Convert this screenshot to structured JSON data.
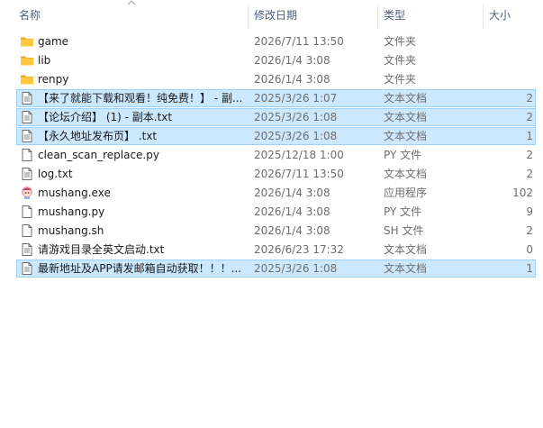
{
  "columns": {
    "name": "名称",
    "date": "修改日期",
    "type": "类型",
    "size": "大小"
  },
  "files": [
    {
      "name": "game",
      "date": "2026/7/11 13:50",
      "type": "文件夹",
      "size": "",
      "icon": "folder-icon",
      "selected": false
    },
    {
      "name": "lib",
      "date": "2026/1/4 3:08",
      "type": "文件夹",
      "size": "",
      "icon": "folder-icon",
      "selected": false
    },
    {
      "name": "renpy",
      "date": "2026/1/4 3:08",
      "type": "文件夹",
      "size": "",
      "icon": "folder-icon",
      "selected": false
    },
    {
      "name": "【来了就能下载和观看！纯免费！】 - 副...",
      "date": "2025/3/26 1:07",
      "type": "文本文档",
      "size": "2",
      "icon": "text-file-icon",
      "selected": true
    },
    {
      "name": "【论坛介绍】 (1) - 副本.txt",
      "date": "2025/3/26 1:08",
      "type": "文本文档",
      "size": "2",
      "icon": "text-file-icon",
      "selected": true
    },
    {
      "name": "【永久地址发布页】 .txt",
      "date": "2025/3/26 1:08",
      "type": "文本文档",
      "size": "1",
      "icon": "text-file-icon",
      "selected": true
    },
    {
      "name": "clean_scan_replace.py",
      "date": "2025/12/18 1:00",
      "type": "PY 文件",
      "size": "2",
      "icon": "file-icon",
      "selected": false
    },
    {
      "name": "log.txt",
      "date": "2026/7/11 13:50",
      "type": "文本文档",
      "size": "2",
      "icon": "text-file-icon",
      "selected": false
    },
    {
      "name": "mushang.exe",
      "date": "2026/1/4 3:08",
      "type": "应用程序",
      "size": "102",
      "icon": "app-icon",
      "selected": false
    },
    {
      "name": "mushang.py",
      "date": "2026/1/4 3:08",
      "type": "PY 文件",
      "size": "9",
      "icon": "file-icon",
      "selected": false
    },
    {
      "name": "mushang.sh",
      "date": "2026/1/4 3:08",
      "type": "SH 文件",
      "size": "2",
      "icon": "file-icon",
      "selected": false
    },
    {
      "name": "请游戏目录全英文启动.txt",
      "date": "2026/6/23 17:32",
      "type": "文本文档",
      "size": "0",
      "icon": "text-file-icon",
      "selected": false
    },
    {
      "name": "最新地址及APP请发邮箱自动获取！！！...",
      "date": "2025/3/26 1:08",
      "type": "文本文档",
      "size": "1",
      "icon": "text-file-icon",
      "selected": true
    }
  ],
  "colors": {
    "selection_bg": "#cce8ff",
    "selection_border": "#99d1ff",
    "folder": "#ffc83d",
    "header_text": "#4c607a"
  }
}
